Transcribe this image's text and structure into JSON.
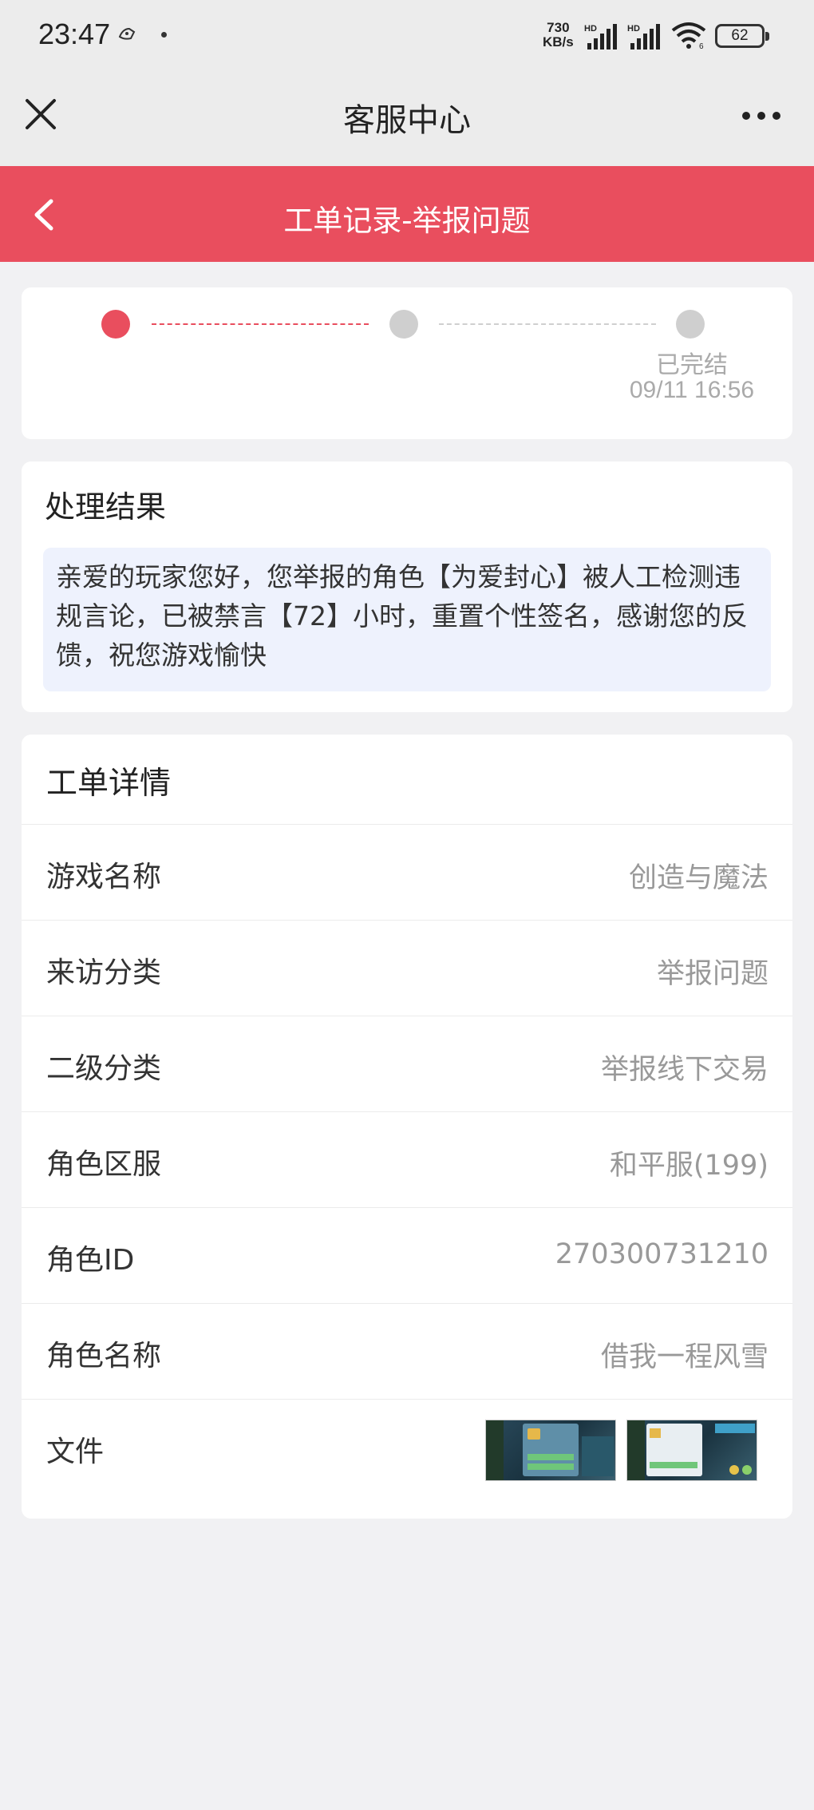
{
  "status_bar": {
    "time": "23:47",
    "net_speed_value": "730",
    "net_speed_unit": "KB/s",
    "signal1_label": "HD",
    "signal2_label": "HD",
    "wifi_badge": "6",
    "battery": "62"
  },
  "app_bar": {
    "title": "客服中心",
    "close_icon": "close-icon",
    "more_icon": "more-icon"
  },
  "header": {
    "title": "工单记录-举报问题",
    "back_icon": "back-icon",
    "color": "#e94e5e"
  },
  "progress": {
    "steps": [
      {
        "label": "",
        "time": "",
        "status": "done"
      },
      {
        "label": "",
        "time": "",
        "status": "pending"
      },
      {
        "label": "已完结",
        "time": "09/11 16:56",
        "status": "pending"
      }
    ]
  },
  "result": {
    "title": "处理结果",
    "text": "亲爱的玩家您好，您举报的角色【为爱封心】被人工检测违规言论，已被禁言【72】小时，重置个性签名，感谢您的反馈，祝您游戏愉快"
  },
  "detail": {
    "title": "工单详情",
    "rows": [
      {
        "label": "游戏名称",
        "value": "创造与魔法"
      },
      {
        "label": "来访分类",
        "value": "举报问题"
      },
      {
        "label": "二级分类",
        "value": "举报线下交易"
      },
      {
        "label": "角色区服",
        "value": "和平服(199)"
      },
      {
        "label": "角色ID",
        "value": "270300731210"
      },
      {
        "label": "角色名称",
        "value": "借我一程风雪"
      }
    ],
    "files_label": "文件",
    "files": [
      "screenshot-thumbnail-1",
      "screenshot-thumbnail-2"
    ]
  }
}
